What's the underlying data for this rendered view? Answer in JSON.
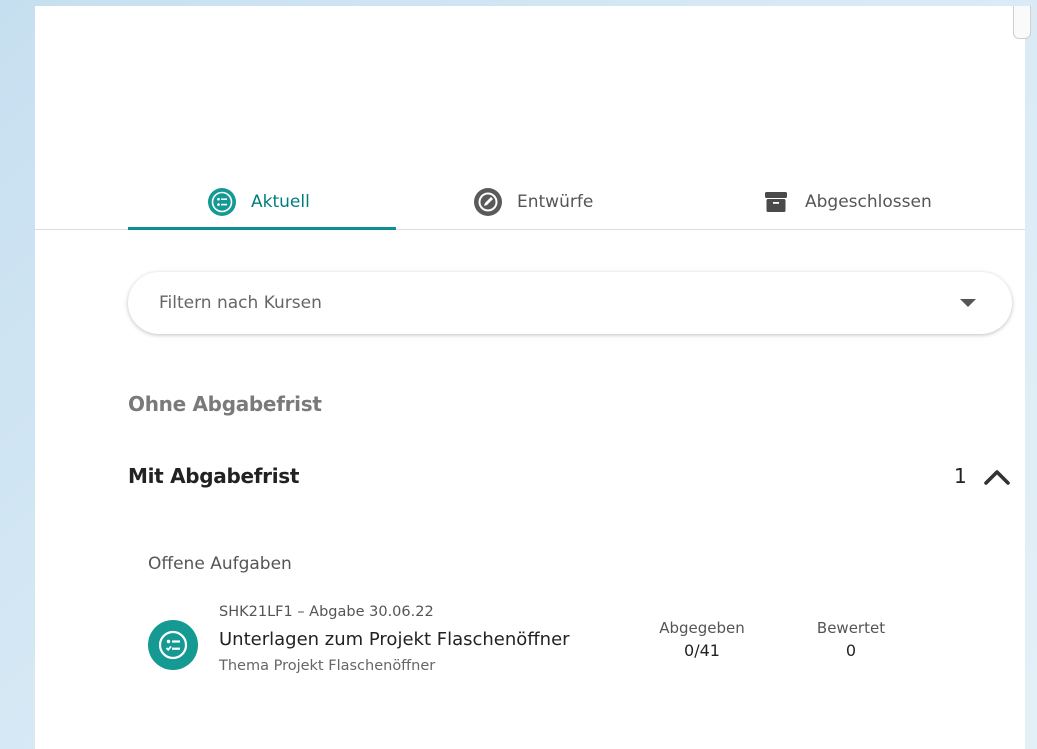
{
  "tabs": [
    {
      "label": "Aktuell",
      "icon": "task-list-icon",
      "active": true
    },
    {
      "label": "Entwürfe",
      "icon": "draft-icon",
      "active": false
    },
    {
      "label": "Abgeschlossen",
      "icon": "archive-icon",
      "active": false
    }
  ],
  "filter": {
    "placeholder": "Filtern nach Kursen"
  },
  "sections": {
    "ohne_abgabefrist": "Ohne Abgabefrist",
    "mit_abgabefrist": "Mit Abgabefrist",
    "mit_abgabefrist_count": "1"
  },
  "offene_aufgaben": {
    "heading": "Offene Aufgaben",
    "task": {
      "meta": "SHK21LF1 – Abgabe 30.06.22",
      "title": "Unterlagen zum Projekt Flaschenöffner",
      "subtitle": "Thema Projekt Flaschenöffner",
      "abgegeben_label": "Abgegeben",
      "abgegeben_value": "0/41",
      "bewertet_label": "Bewertet",
      "bewertet_value": "0"
    }
  },
  "colors": {
    "accent": "#0f8f8f",
    "icon_bg": "#159a93"
  }
}
